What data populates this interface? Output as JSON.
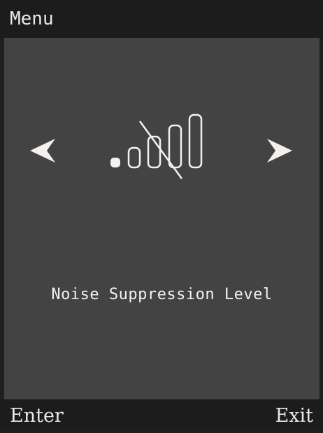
{
  "header": {
    "title": "Menu"
  },
  "main": {
    "caption": "Noise Suppression Level",
    "icon": "signal-bars-crossed-icon",
    "left_arrow_icon": "chevron-left-icon",
    "right_arrow_icon": "chevron-right-icon"
  },
  "softkeys": {
    "left_label": "Enter",
    "right_label": "Exit"
  },
  "colors": {
    "bars_background": "#1c1c1c",
    "content_background": "#434343",
    "foreground": "#f2f2f2"
  }
}
